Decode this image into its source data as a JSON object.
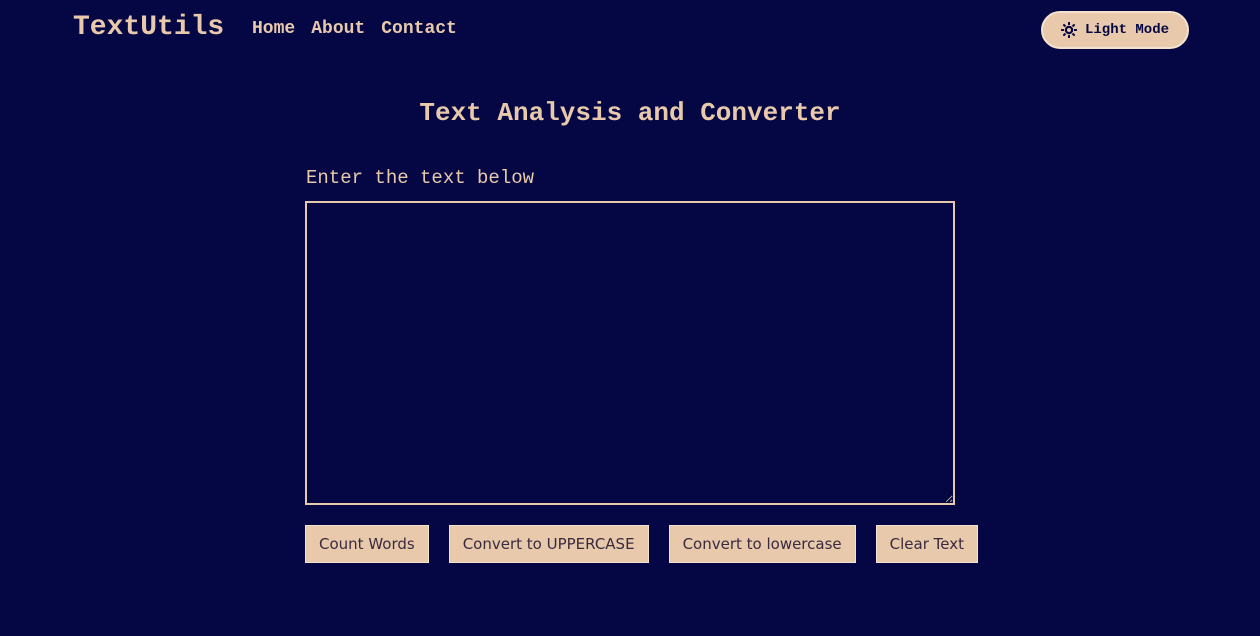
{
  "navbar": {
    "brand": "TextUtils",
    "links": [
      {
        "label": "Home"
      },
      {
        "label": "About"
      },
      {
        "label": "Contact"
      }
    ],
    "mode_toggle": {
      "label": "Light Mode",
      "icon": "sun-icon"
    }
  },
  "main": {
    "title": "Text Analysis and Converter",
    "input_label": "Enter the text below",
    "text_value": "",
    "buttons": [
      {
        "label": "Count Words"
      },
      {
        "label": "Convert to UPPERCASE"
      },
      {
        "label": "Convert to lowercase"
      },
      {
        "label": "Clear Text"
      }
    ]
  },
  "colors": {
    "background": "#050744",
    "accent": "#e8c9ab",
    "button_text": "#3a2a3e"
  }
}
